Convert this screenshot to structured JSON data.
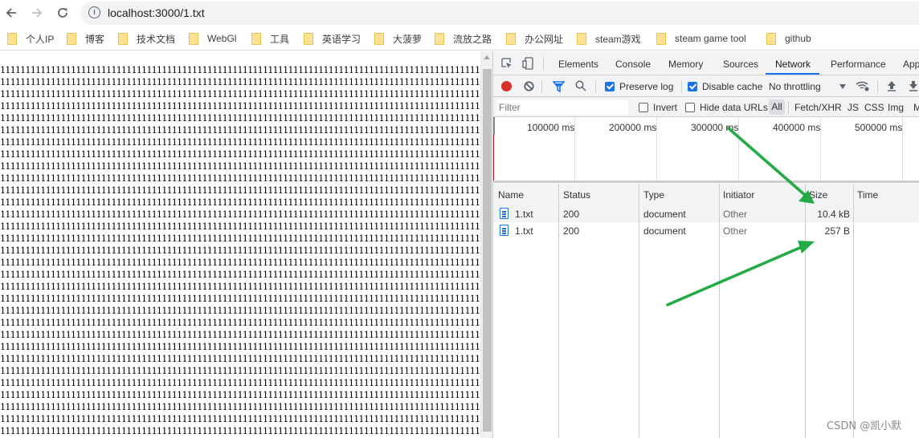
{
  "browser": {
    "url": "localhost:3000/1.txt",
    "back_icon": "arrow-left-icon",
    "forward_icon": "arrow-right-icon",
    "reload_icon": "reload-icon"
  },
  "bookmarks": [
    {
      "label": "个人IP"
    },
    {
      "label": "博客"
    },
    {
      "label": "技术文档"
    },
    {
      "label": "WebGl"
    },
    {
      "label": "工具"
    },
    {
      "label": "英语学习"
    },
    {
      "label": "大菠萝"
    },
    {
      "label": "流放之路"
    },
    {
      "label": "办公网址"
    },
    {
      "label": "steam游戏"
    },
    {
      "label": "steam game tool"
    },
    {
      "label": "github"
    }
  ],
  "page": {
    "line_char": "1",
    "line_length": 98,
    "line_count": 31
  },
  "devtools": {
    "tabs": [
      {
        "label": "Elements"
      },
      {
        "label": "Console"
      },
      {
        "label": "Memory"
      },
      {
        "label": "Sources"
      },
      {
        "label": "Network",
        "active": true
      },
      {
        "label": "Performance"
      },
      {
        "label": "App"
      }
    ],
    "toolbar": {
      "preserve_log": {
        "label": "Preserve log",
        "checked": true
      },
      "disable_cache": {
        "label": "Disable cache",
        "checked": true
      },
      "throttling": "No throttling"
    },
    "filter": {
      "placeholder": "Filter",
      "invert": {
        "label": "Invert",
        "checked": false
      },
      "hide_data_urls": {
        "label": "Hide data URLs",
        "checked": false
      },
      "types": [
        "All",
        "Fetch/XHR",
        "JS",
        "CSS",
        "Img",
        "M"
      ]
    },
    "overview": {
      "ticks": [
        "100000 ms",
        "200000 ms",
        "300000 ms",
        "400000 ms",
        "500000 ms"
      ]
    },
    "table": {
      "columns": [
        "Name",
        "Status",
        "Type",
        "Initiator",
        "Size",
        "Time"
      ],
      "rows": [
        {
          "name": "1.txt",
          "status": "200",
          "type": "document",
          "initiator": "Other",
          "size": "10.4 kB",
          "time": ""
        },
        {
          "name": "1.txt",
          "status": "200",
          "type": "document",
          "initiator": "Other",
          "size": "257 B",
          "time": ""
        }
      ]
    }
  },
  "annotation": {
    "arrow_color": "#22aa44"
  },
  "watermark": "CSDN @凯小默",
  "colors": {
    "accent": "#1a73e8",
    "record": "#d93025",
    "folder": "#fde293"
  }
}
